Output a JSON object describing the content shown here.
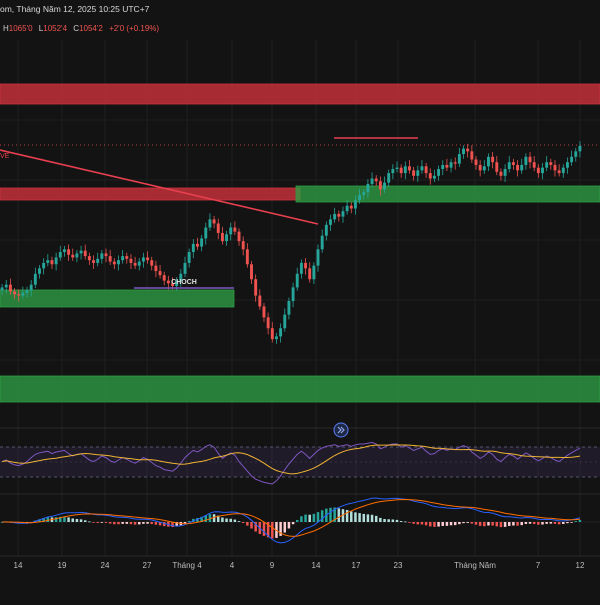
{
  "header": {
    "title_fragment": "om, Tháng Năm 12, 2025 10:25 UTC+7",
    "ohlc": {
      "h_label": "H",
      "h": "1065'0",
      "l_label": "L",
      "l": "1052'4",
      "c_label": "C",
      "c": "1054'2",
      "change": "+2'0 (+0.19%)"
    }
  },
  "colors": {
    "background": "#131313",
    "up": "#26a69a",
    "down": "#ef5350",
    "supply_zone": "#d0323c",
    "demand_zone": "#2e9e44",
    "trendline": "#e8404f",
    "rsi": "#7e57c2",
    "rsi_ma": "#f0b433",
    "macd": "#2962ff",
    "signal": "#ff6d00"
  },
  "chart_data": {
    "type": "candlestick",
    "x_tick_labels": [
      "14",
      "19",
      "24",
      "27",
      "Tháng 4",
      "4",
      "9",
      "14",
      "17",
      "23",
      "Tháng Năm",
      "7",
      "12"
    ],
    "annotations": [
      {
        "text": "CHOCH",
        "kind": "label"
      },
      {
        "text": "VE",
        "kind": "label"
      }
    ],
    "zones": [
      {
        "kind": "supply",
        "note": "top resistance band"
      },
      {
        "kind": "supply",
        "note": "mid resistance band"
      },
      {
        "kind": "demand",
        "note": "upper support band"
      },
      {
        "kind": "demand",
        "note": "lower-left support band"
      },
      {
        "kind": "demand",
        "note": "bottom support band"
      }
    ],
    "indicators": [
      "RSI with moving average",
      "MACD histogram with signal lines"
    ],
    "grid": true,
    "legend": "none",
    "price_closes": [
      8,
      10,
      5,
      3,
      2,
      4,
      6,
      10,
      18,
      22,
      26,
      28,
      25,
      30,
      34,
      36,
      32,
      30,
      33,
      35,
      31,
      28,
      26,
      29,
      33,
      31,
      27,
      25,
      28,
      31,
      29,
      26,
      24,
      27,
      30,
      28,
      24,
      20,
      17,
      13,
      11,
      9,
      13,
      18,
      26,
      34,
      40,
      38,
      44,
      52,
      58,
      55,
      48,
      42,
      47,
      52,
      49,
      42,
      36,
      25,
      14,
      2,
      -6,
      -14,
      -22,
      -30,
      -28,
      -22,
      -12,
      -2,
      8,
      18,
      26,
      22,
      14,
      24,
      36,
      46,
      54,
      58,
      62,
      60,
      64,
      68,
      66,
      72,
      76,
      78,
      84,
      88,
      86,
      80,
      85,
      92,
      95,
      96,
      92,
      97,
      94,
      90,
      94,
      97,
      92,
      88,
      90,
      95,
      98,
      96,
      100,
      99,
      106,
      110,
      108,
      102,
      98,
      94,
      97,
      104,
      100,
      93,
      90,
      95,
      100,
      98,
      94,
      98,
      104,
      100,
      96,
      92,
      96,
      100,
      98,
      94,
      92,
      96,
      100,
      104,
      108,
      112
    ],
    "rsi_values": [
      48,
      50,
      46,
      44,
      43,
      45,
      48,
      53,
      57,
      59,
      60,
      61,
      58,
      60,
      61,
      62,
      58,
      55,
      57,
      58,
      54,
      50,
      48,
      51,
      55,
      53,
      49,
      47,
      50,
      53,
      51,
      48,
      46,
      49,
      53,
      51,
      47,
      43,
      41,
      38,
      37,
      36,
      40,
      46,
      53,
      58,
      62,
      60,
      63,
      67,
      69,
      66,
      58,
      52,
      56,
      59,
      56,
      48,
      42,
      36,
      30,
      26,
      24,
      22,
      21,
      20,
      24,
      30,
      38,
      45,
      51,
      57,
      61,
      57,
      52,
      57,
      62,
      65,
      67,
      68,
      69,
      67,
      68,
      69,
      67,
      69,
      70,
      70,
      71,
      72,
      70,
      64,
      66,
      69,
      70,
      70,
      66,
      68,
      65,
      62,
      64,
      66,
      61,
      57,
      58,
      62,
      64,
      62,
      64,
      63,
      66,
      68,
      66,
      60,
      56,
      52,
      55,
      60,
      57,
      51,
      48,
      53,
      57,
      55,
      51,
      55,
      59,
      56,
      52,
      49,
      52,
      55,
      53,
      50,
      48,
      52,
      56,
      59,
      62,
      65
    ]
  }
}
